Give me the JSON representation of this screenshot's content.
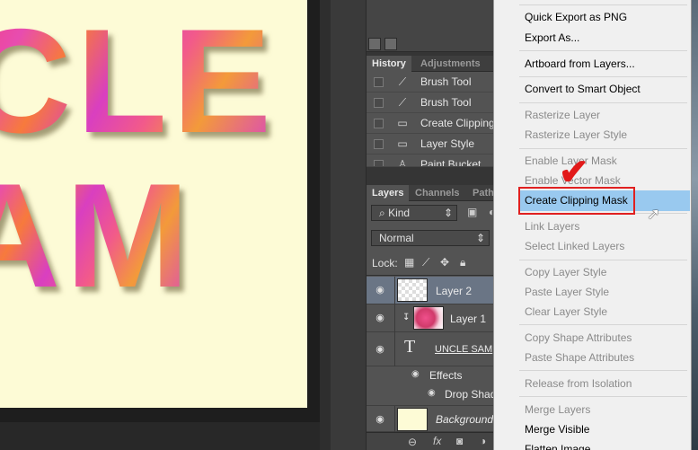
{
  "canvas": {
    "line1": "CLE",
    "line2": "AM",
    "background": "#fdfbd6"
  },
  "history": {
    "tabs": [
      "History",
      "Adjustments"
    ],
    "items": [
      {
        "icon": "brush-icon",
        "label": "Brush Tool"
      },
      {
        "icon": "brush-icon",
        "label": "Brush Tool"
      },
      {
        "icon": "document-icon",
        "label": "Create Clipping"
      },
      {
        "icon": "document-icon",
        "label": "Layer Style"
      },
      {
        "icon": "bucket-icon",
        "label": "Paint Bucket"
      }
    ]
  },
  "layers": {
    "tabs": [
      "Layers",
      "Channels",
      "Path"
    ],
    "filter": "Kind",
    "blend_mode": "Normal",
    "lock_label": "Lock:",
    "items": [
      {
        "name": "Layer 2",
        "selected": true
      },
      {
        "name": "Layer 1",
        "clipped": true
      },
      {
        "name": "UNCLE SAM",
        "type": "text"
      },
      {
        "name": "Effects"
      },
      {
        "name": "Drop Shad"
      },
      {
        "name": "Background"
      }
    ]
  },
  "menu": {
    "items": [
      {
        "label": "Quick Export as PNG",
        "enabled": true
      },
      {
        "label": "Export As...",
        "enabled": true
      },
      {
        "label": "Artboard from Layers...",
        "enabled": true
      },
      {
        "label": "Convert to Smart Object",
        "enabled": true
      },
      {
        "label": "Rasterize Layer",
        "enabled": false
      },
      {
        "label": "Rasterize Layer Style",
        "enabled": false
      },
      {
        "label": "Enable Layer Mask",
        "enabled": false
      },
      {
        "label": "Enable Vector Mask",
        "enabled": false
      },
      {
        "label": "Create Clipping Mask",
        "enabled": true,
        "highlighted": true
      },
      {
        "label": "Link Layers",
        "enabled": false
      },
      {
        "label": "Select Linked Layers",
        "enabled": false
      },
      {
        "label": "Copy Layer Style",
        "enabled": false
      },
      {
        "label": "Paste Layer Style",
        "enabled": false
      },
      {
        "label": "Clear Layer Style",
        "enabled": false
      },
      {
        "label": "Copy Shape Attributes",
        "enabled": false
      },
      {
        "label": "Paste Shape Attributes",
        "enabled": false
      },
      {
        "label": "Release from Isolation",
        "enabled": false
      },
      {
        "label": "Merge Layers",
        "enabled": false
      },
      {
        "label": "Merge Visible",
        "enabled": true
      },
      {
        "label": "Flatten Image",
        "enabled": true
      }
    ],
    "highlight_color": "#99c9ef",
    "annotation_color": "#e02020"
  }
}
